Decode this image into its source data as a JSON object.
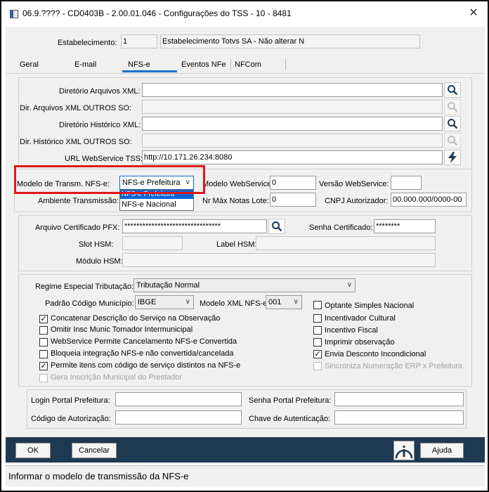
{
  "window": {
    "title": "06.9.???? - CD0403B - 2.00.01.046 - Configurações do TSS - 10 - 8481"
  },
  "estab": {
    "label": "Estabelecimento:",
    "code": "1",
    "name": "Estabelecimento Totvs SA - Não alterar N"
  },
  "tabs": [
    "Geral",
    "E-mail",
    "NFS-e",
    "Eventos NFe",
    "NFCom"
  ],
  "dirs": {
    "dir_xml_label": "Diretório Arquivos XML:",
    "dir_xml_outros_label": "Dir. Arquivos XML OUTROS SO:",
    "dir_hist_label": "Diretório Histórico XML:",
    "dir_hist_outros_label": "Dir. Histórico XML OUTROS SO:",
    "url_label": "URL WebService TSS:",
    "url_value": "http://10.171.26.234:8080"
  },
  "transm": {
    "modelo_label": "Modelo de Transm. NFS-e:",
    "modelo_value": "NFS-e Prefeitura",
    "options": [
      "NFS-e Prefeitura",
      "NFS-e Nacional"
    ],
    "modelo_ws_label": "Modelo WebService:",
    "modelo_ws_value": "0",
    "versao_ws_label": "Versão WebService:",
    "ambiente_label": "Ambiente Transmissão:",
    "nr_max_label": "Nr Máx Notas Lote:",
    "nr_max_value": "0",
    "cnpj_label": "CNPJ Autorizador:",
    "cnpj_value": "00.000.000/0000-00"
  },
  "cert": {
    "arquivo_label": "Arquivo Certificado PFX:",
    "arquivo_value": "********************************",
    "senha_label": "Senha Certificado:",
    "senha_value": "********",
    "slot_label": "Slot HSM:",
    "label_hsm_label": "Label HSM:",
    "modulo_label": "Módulo HSM:"
  },
  "regime": {
    "regime_label": "Regime Especial Tributação:",
    "regime_value": "Tributação Normal",
    "padrao_label": "Padrão Código Município:",
    "padrao_value": "IBGE",
    "modelo_xml_label": "Modelo XML NFS-e:",
    "modelo_xml_value": "001"
  },
  "checks_left": [
    {
      "label": "Concatenar Descrição do Serviço na Observação",
      "checked": true,
      "disabled": false
    },
    {
      "label": "Omitir Insc Munic Tomador Intermunicipal",
      "checked": false,
      "disabled": false
    },
    {
      "label": "WebService Permite Cancelamento NFS-e Convertida",
      "checked": false,
      "disabled": false
    },
    {
      "label": "Bloqueia integração NFS-e não convertida/cancelada",
      "checked": false,
      "disabled": false
    },
    {
      "label": "Permite itens com código de serviço distintos na NFS-e",
      "checked": true,
      "disabled": false
    },
    {
      "label": "Gera Inscrição Municipal do Prestador",
      "checked": false,
      "disabled": true
    }
  ],
  "checks_right": [
    {
      "label": "Optante Simples Nacional",
      "checked": false,
      "disabled": false
    },
    {
      "label": "Incentivador Cultural",
      "checked": false,
      "disabled": false
    },
    {
      "label": "Incentivo Fiscal",
      "checked": false,
      "disabled": false
    },
    {
      "label": "Imprimir observação",
      "checked": false,
      "disabled": false
    },
    {
      "label": "Envia Desconto Incondicional",
      "checked": true,
      "disabled": false
    },
    {
      "label": "Sincroniza Numeração ERP x Prefeitura",
      "checked": false,
      "disabled": true
    }
  ],
  "portal": {
    "login_label": "Login Portal Prefeitura:",
    "senha_label": "Senha Portal Prefeitura:",
    "codigo_label": "Código de Autorização:",
    "chave_label": "Chave de Autenticação:"
  },
  "footer": {
    "ok": "OK",
    "cancelar": "Cancelar",
    "ajuda": "Ajuda"
  },
  "status": "Informar o modelo de transmissão da NFS-e",
  "colors": {
    "footer_bg": "#1e3a52",
    "highlight": "#e01818",
    "tab_underline": "#1a73c8",
    "selection": "#0a64d6"
  }
}
